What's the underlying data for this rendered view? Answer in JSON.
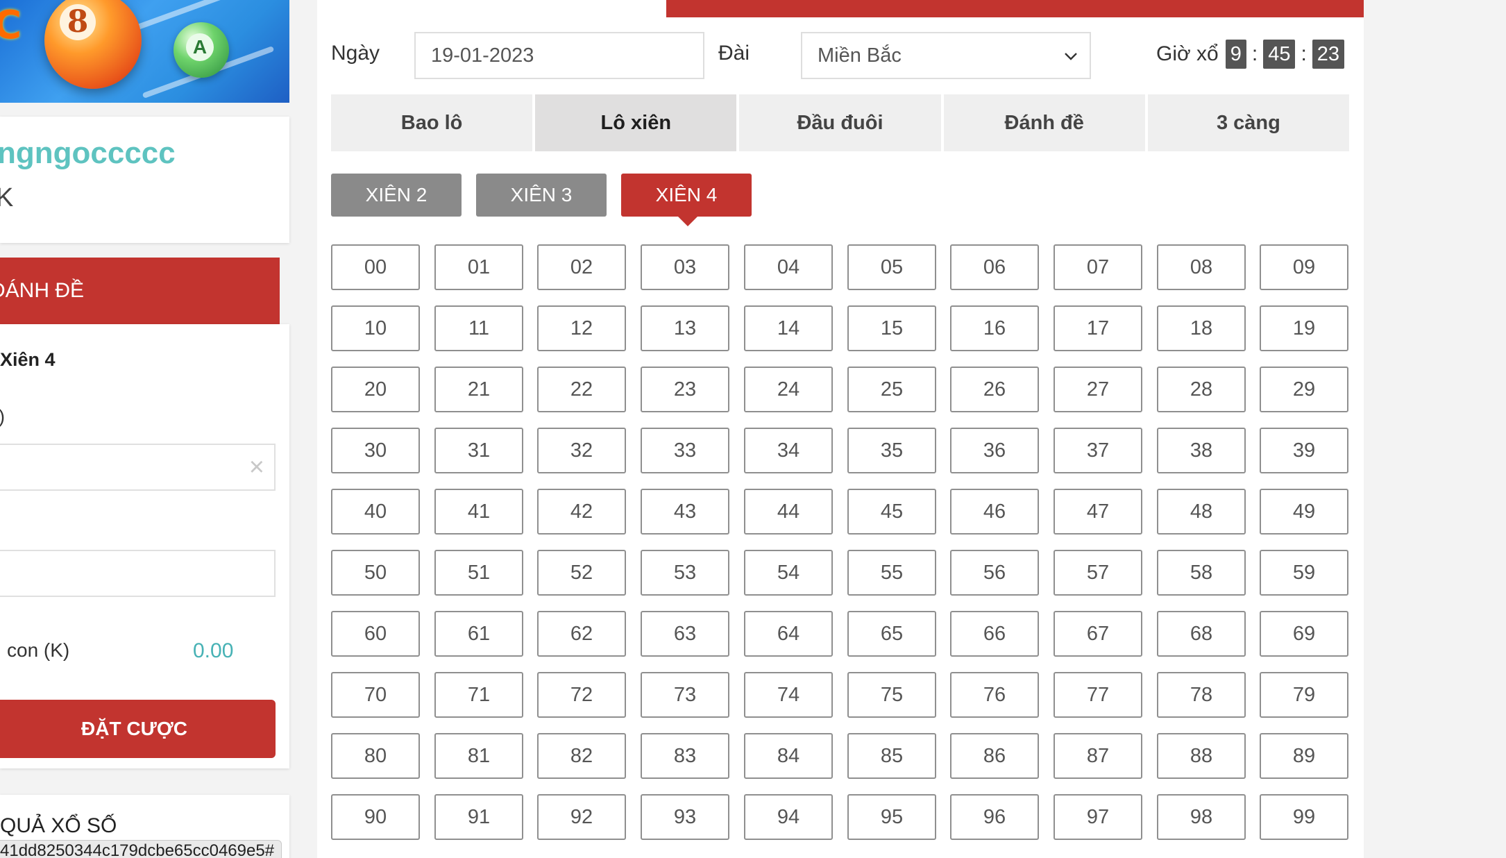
{
  "sidebar": {
    "banner": {
      "letter": "C",
      "ball_number": "8",
      "ball2_letter": "A"
    },
    "username": "ngngoccccc",
    "user_sub": "K",
    "bet_header": "ĐÁNH ĐỀ",
    "bet_type": "Xiên 4",
    "bet_paren": ")",
    "clear_icon": "×",
    "summary_label": "con (K)",
    "summary_value": "0.00",
    "place_bet_label": "ĐẶT CƯỢC",
    "results_title": "QUẢ XỔ SỐ",
    "status_url": "41dd8250344c179dcbe65cc0469e5#"
  },
  "main": {
    "date_label": "Ngày",
    "date_value": "19-01-2023",
    "station_label": "Đài",
    "station_value": "Miền Bắc",
    "timer": {
      "label": "Giờ xổ",
      "hours": "9",
      "minutes": "45",
      "seconds": "23",
      "sep": ":"
    },
    "tabs": [
      {
        "label": "Bao lô",
        "active": false
      },
      {
        "label": "Lô xiên",
        "active": true
      },
      {
        "label": "Đầu đuôi",
        "active": false
      },
      {
        "label": "Đánh đề",
        "active": false
      },
      {
        "label": "3 càng",
        "active": false
      }
    ],
    "subtabs": [
      {
        "label": "XIÊN 2",
        "active": false
      },
      {
        "label": "XIÊN 3",
        "active": false
      },
      {
        "label": "XIÊN 4",
        "active": true
      }
    ],
    "numbers": [
      "00",
      "01",
      "02",
      "03",
      "04",
      "05",
      "06",
      "07",
      "08",
      "09",
      "10",
      "11",
      "12",
      "13",
      "14",
      "15",
      "16",
      "17",
      "18",
      "19",
      "20",
      "21",
      "22",
      "23",
      "24",
      "25",
      "26",
      "27",
      "28",
      "29",
      "30",
      "31",
      "32",
      "33",
      "34",
      "35",
      "36",
      "37",
      "38",
      "39",
      "40",
      "41",
      "42",
      "43",
      "44",
      "45",
      "46",
      "47",
      "48",
      "49",
      "50",
      "51",
      "52",
      "53",
      "54",
      "55",
      "56",
      "57",
      "58",
      "59",
      "60",
      "61",
      "62",
      "63",
      "64",
      "65",
      "66",
      "67",
      "68",
      "69",
      "70",
      "71",
      "72",
      "73",
      "74",
      "75",
      "76",
      "77",
      "78",
      "79",
      "80",
      "81",
      "82",
      "83",
      "84",
      "85",
      "86",
      "87",
      "88",
      "89",
      "90",
      "91",
      "92",
      "93",
      "94",
      "95",
      "96",
      "97",
      "98",
      "99"
    ]
  },
  "colors": {
    "brand_red": "#c2342f",
    "accent_teal": "#5ec3c0",
    "subtab_gray": "#8a8a8a",
    "timer_box": "#555555"
  },
  "icons": {
    "clear": "close-icon",
    "select": "chevron-down-icon"
  }
}
